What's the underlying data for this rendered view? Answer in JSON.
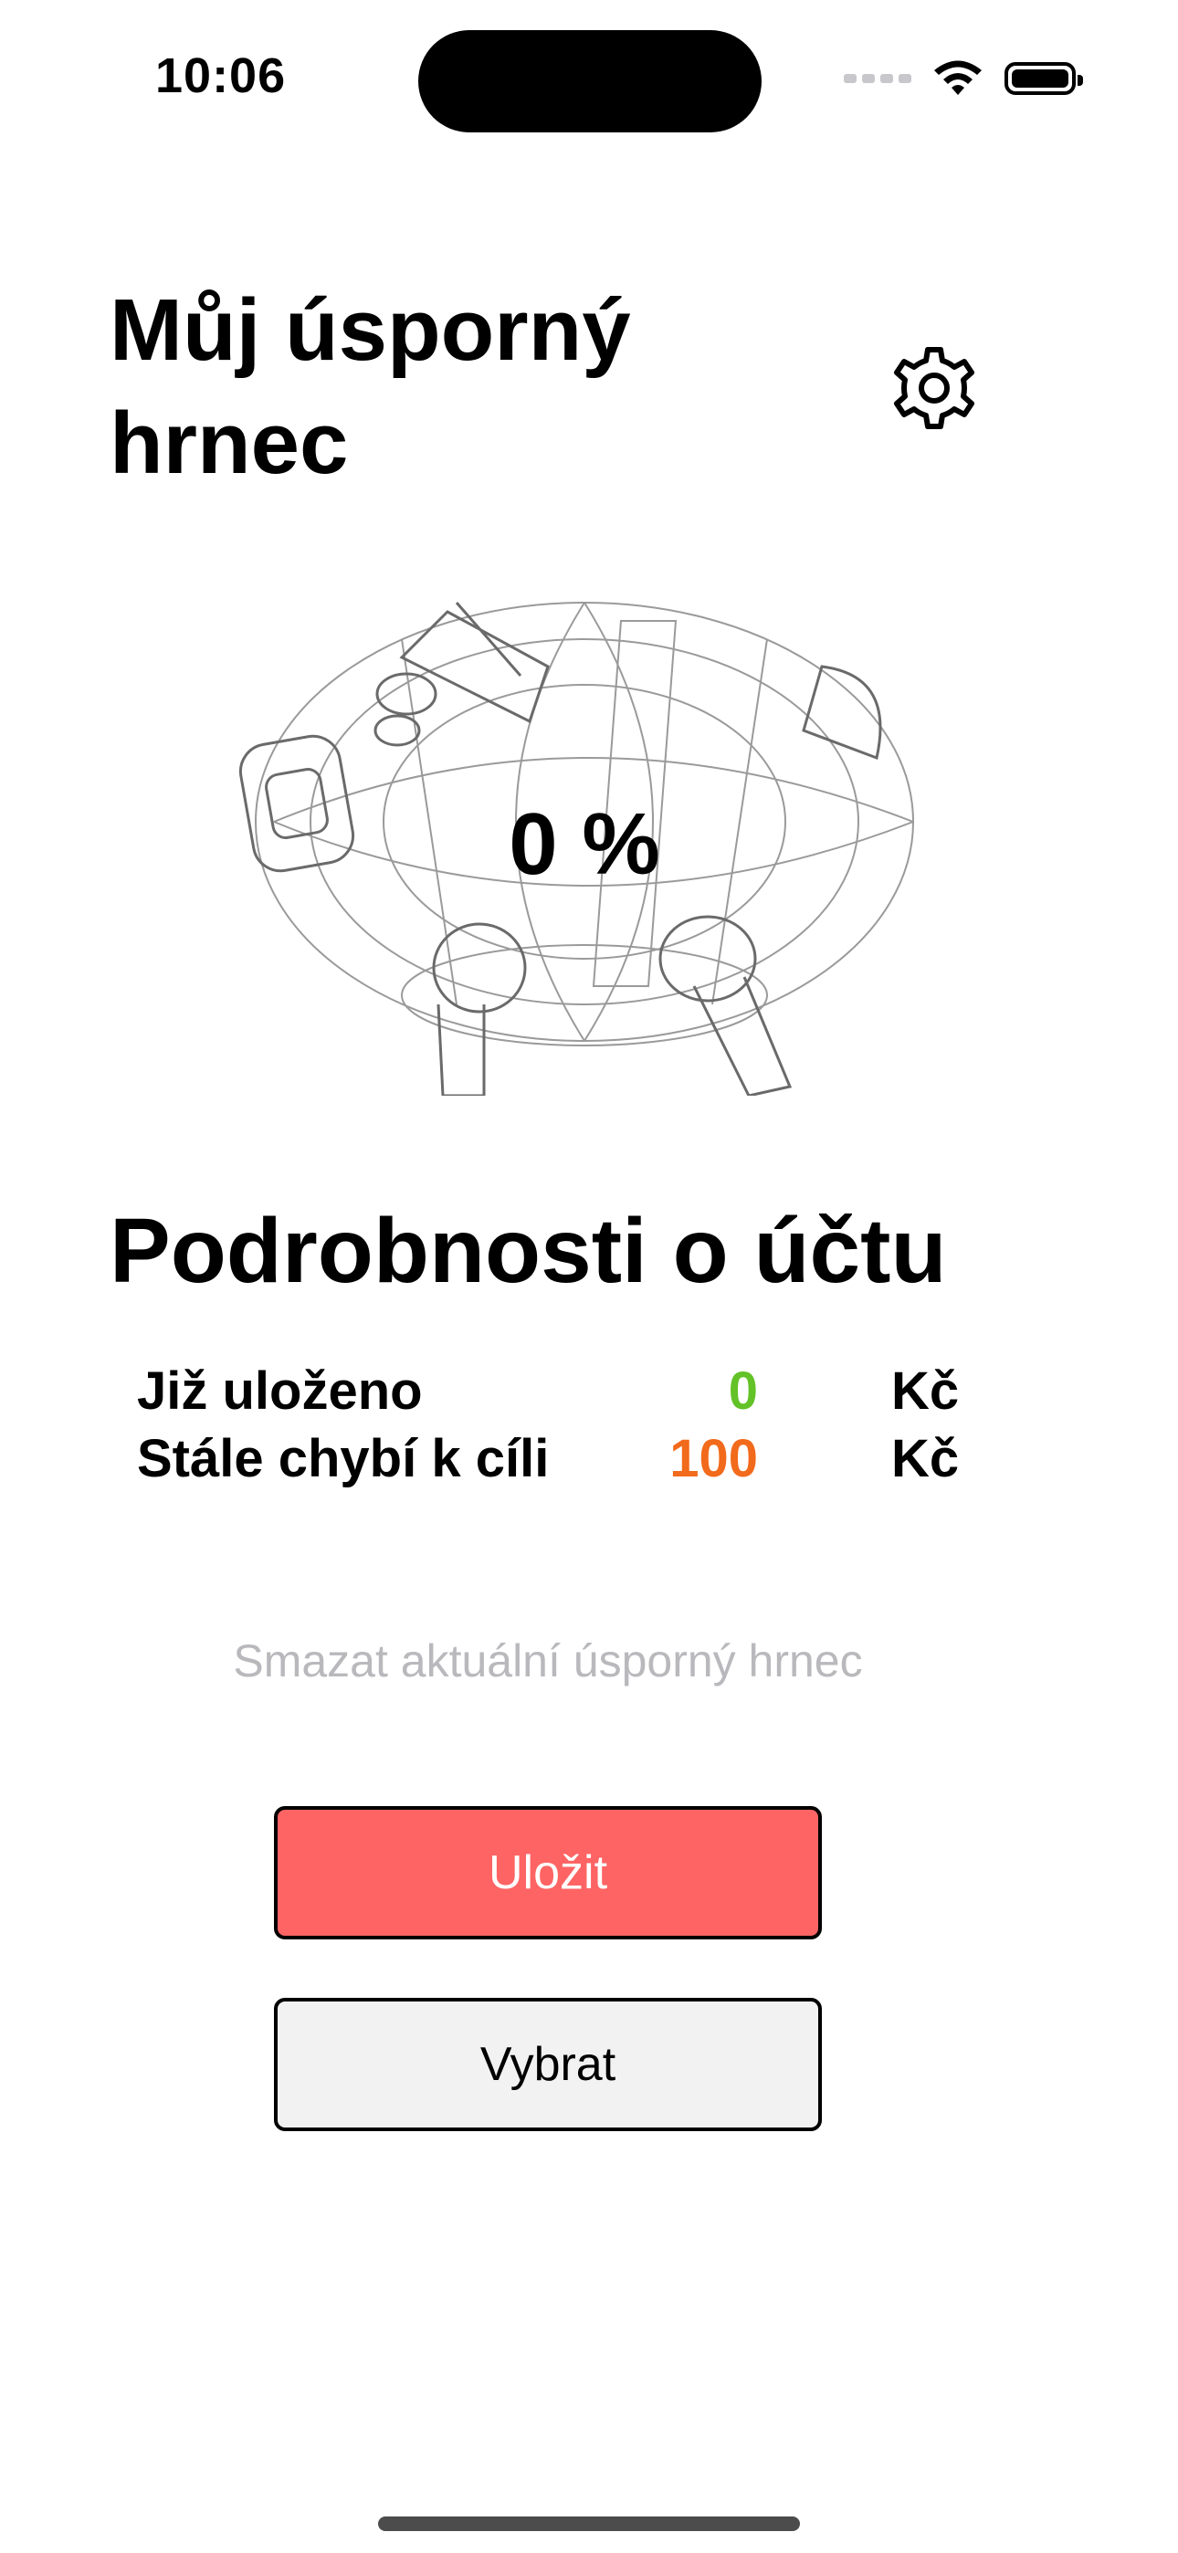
{
  "status_bar": {
    "time": "10:06"
  },
  "header": {
    "title": "Můj úsporný hrnec"
  },
  "piggy_bank": {
    "progress_label": "0 %",
    "progress_percent": 0
  },
  "account": {
    "section_title": "Podrobnosti o účtu",
    "rows": [
      {
        "label": "Již uloženo",
        "value": "0",
        "unit": "Kč",
        "value_color": "#62c227"
      },
      {
        "label": "Stále chybí k cíli",
        "value": "100",
        "unit": "Kč",
        "value_color": "#f26a1b"
      }
    ]
  },
  "actions": {
    "delete_label": "Smazat aktuální úsporný hrnec",
    "save_label": "Uložit",
    "withdraw_label": "Vybrat"
  },
  "colors": {
    "save_button": "#fe6464",
    "withdraw_button": "#f2f2f2"
  },
  "icons": {
    "settings": "gear-icon",
    "wifi": "wifi-icon",
    "battery": "battery-icon"
  }
}
